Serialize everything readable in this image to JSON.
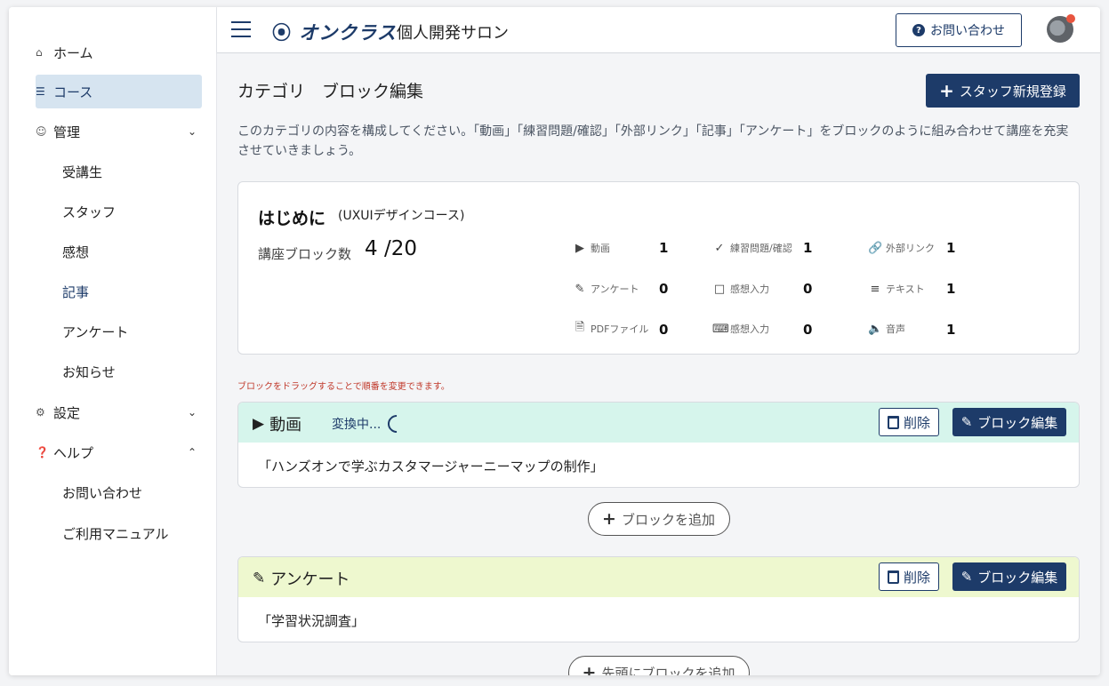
{
  "sidebar": {
    "items": [
      {
        "label": "ホーム",
        "icon": "home-icon"
      },
      {
        "label": "コース",
        "icon": "list-icon"
      },
      {
        "label": "管理",
        "icon": "users-icon"
      },
      {
        "label": "受講生"
      },
      {
        "label": "スタッフ"
      },
      {
        "label": "感想"
      },
      {
        "label": "記事"
      },
      {
        "label": "アンケート"
      },
      {
        "label": "お知らせ"
      },
      {
        "label": "設定",
        "icon": "gear-icon"
      },
      {
        "label": "ヘルプ",
        "icon": "question-circle-icon"
      },
      {
        "label": "お問い合わせ"
      },
      {
        "label": "ご利用マニュアル"
      }
    ]
  },
  "header": {
    "logo": "オンクラス",
    "salon": "個人開発サロン",
    "contact_label": "お問い合わせ"
  },
  "page": {
    "title": "カテゴリ　ブロック編集",
    "staff_button": "スタッフ新規登録",
    "description": "このカテゴリの内容を構成してください。「動画」「練習問題/確認」「外部リンク」「記事」「アンケート」をブロックのように組み合わせて講座を充実させていきましょう。"
  },
  "summary": {
    "title": "はじめに",
    "subtitle": "(UXUIデザインコース)",
    "count_label": "講座ブロック数",
    "count_value": "4 /20",
    "stats": [
      {
        "label": "動画",
        "value": "1",
        "icon": "play-circle-icon"
      },
      {
        "label": "練習問題/確認",
        "value": "1",
        "icon": "check-circle-icon"
      },
      {
        "label": "外部リンク",
        "value": "1",
        "icon": "link-icon"
      },
      {
        "label": "アンケート",
        "value": "0",
        "icon": "pencil-icon"
      },
      {
        "label": "感想入力",
        "value": "0",
        "icon": "comment-icon"
      },
      {
        "label": "テキスト",
        "value": "1",
        "icon": "text-icon"
      },
      {
        "label": "PDFファイル",
        "value": "0",
        "icon": "pdf-file-icon"
      },
      {
        "label": "感想入力",
        "value": "0",
        "icon": "keyboard-icon"
      },
      {
        "label": "音声",
        "value": "1",
        "icon": "speaker-icon"
      }
    ]
  },
  "drag_note": "ブロックをドラッグすることで順番を変更できます。",
  "blocks": [
    {
      "type": "動画",
      "status": "変換中...",
      "content": "「ハンズオンで学ぶカスタマージャーニーマップの制作」",
      "delete_label": "削除",
      "edit_label": "ブロック編集"
    },
    {
      "type": "アンケート",
      "content": "「学習状況調査」",
      "delete_label": "削除",
      "edit_label": "ブロック編集"
    }
  ],
  "add_block_label": "ブロックを追加",
  "add_top_label": "先頭にブロックを追加",
  "colors": {
    "primary": "#1d3b69",
    "video_header": "#d6f5ec",
    "survey_header": "#eef8cf",
    "note": "#c0392b",
    "active_nav": "#d6e4f0"
  }
}
